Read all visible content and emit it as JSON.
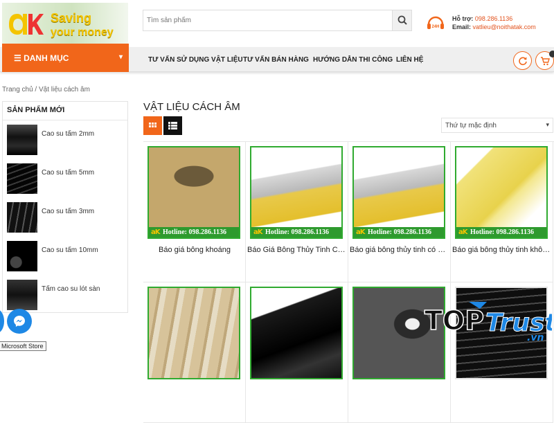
{
  "brand": {
    "mark": "aK",
    "line1": "Saving",
    "line2": "your money"
  },
  "search": {
    "placeholder": "Tìm sản phẩm"
  },
  "support": {
    "phone_label": "Hỗ trợ:",
    "phone": "098.286.1136",
    "email_label": "Email:",
    "email": "vatlieu@noithatak.com",
    "icon_text": "24H"
  },
  "nav": {
    "danh_muc": "DANH MỤC",
    "items": [
      "TƯ VẤN SỬ DỤNG VẬT LIỆU",
      "TƯ VẤN BÁN HÀNG",
      "HƯỚNG DẪN THI CÔNG",
      "LIÊN HỆ"
    ]
  },
  "breadcrumb": "Trang chủ / Vật liệu cách âm",
  "sidebar": {
    "title": "SẢN PHẨM MỚI",
    "items": [
      {
        "name": "Cao su tấm 2mm"
      },
      {
        "name": "Cao su tấm 5mm"
      },
      {
        "name": "Cao su tấm 3mm"
      },
      {
        "name": "Cao su tấm 10mm"
      },
      {
        "name": "Tấm cao su lót sàn"
      }
    ]
  },
  "category": {
    "title": "VẬT LIỆU CÁCH ÂM",
    "sort": "Thứ tự mặc định"
  },
  "hotline_text": "Hotline: 098.286.1136",
  "products": [
    {
      "name": "Báo giá bông khoáng"
    },
    {
      "name": "Báo Giá Bông Thủy Tinh Có Bạc"
    },
    {
      "name": "Báo giá bông thủy tinh có bạc"
    },
    {
      "name": "Báo giá bông thủy tinh không bạc"
    },
    {
      "name": ""
    },
    {
      "name": ""
    },
    {
      "name": ""
    },
    {
      "name": ""
    }
  ],
  "tooltip": "Microsoft Store",
  "watermark": {
    "top": "TOP",
    "trust": "Trust",
    "vn": ".vn"
  },
  "colors": {
    "accent": "#f1661a",
    "green": "#2faa2f",
    "blue": "#1e88e5"
  }
}
